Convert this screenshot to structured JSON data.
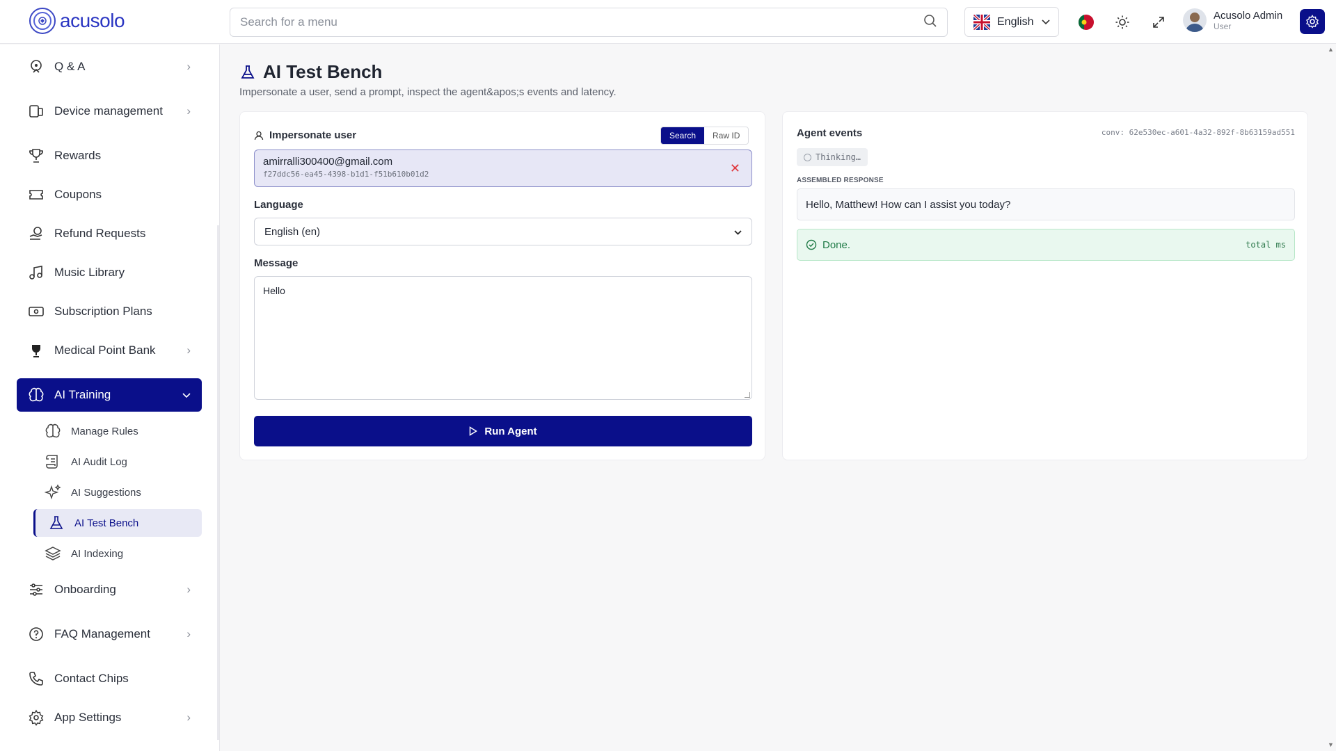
{
  "header": {
    "logo_text": "acusolo",
    "search_placeholder": "Search for a menu",
    "language": "English",
    "user_name": "Acusolo Admin",
    "user_role": "User"
  },
  "sidebar": {
    "items": [
      {
        "label": "Q & A",
        "icon": "qa-icon"
      },
      {
        "label": "Device management",
        "icon": "device-icon"
      },
      {
        "label": "Rewards",
        "icon": "trophy-icon"
      },
      {
        "label": "Coupons",
        "icon": "ticket-icon"
      },
      {
        "label": "Refund Requests",
        "icon": "refund-icon"
      },
      {
        "label": "Music Library",
        "icon": "music-icon"
      },
      {
        "label": "Subscription Plans",
        "icon": "subscription-icon"
      },
      {
        "label": "Medical Point Bank",
        "icon": "medal-icon"
      },
      {
        "label": "AI Training",
        "icon": "brain-icon"
      },
      {
        "label": "Onboarding",
        "icon": "sliders-icon"
      },
      {
        "label": "FAQ Management",
        "icon": "help-icon"
      },
      {
        "label": "Contact Chips",
        "icon": "phone-icon"
      },
      {
        "label": "App Settings",
        "icon": "gear-icon"
      }
    ],
    "sub_items": [
      {
        "label": "Manage Rules",
        "icon": "brain-icon"
      },
      {
        "label": "AI Audit Log",
        "icon": "scroll-icon"
      },
      {
        "label": "AI Suggestions",
        "icon": "sparkles-icon"
      },
      {
        "label": "AI Test Bench",
        "icon": "flask-icon"
      },
      {
        "label": "AI Indexing",
        "icon": "layers-icon"
      }
    ]
  },
  "page": {
    "title": "AI Test Bench",
    "subtitle": "Impersonate a user, send a prompt, inspect the agent&apos;s events and latency."
  },
  "form": {
    "impersonate_label": "Impersonate user",
    "toggle_search": "Search",
    "toggle_raw": "Raw ID",
    "user_email": "amirralli300400@gmail.com",
    "user_id": "f27ddc56-ea45-4398-b1d1-f51b610b01d2",
    "language_label": "Language",
    "language_value": "English (en)",
    "message_label": "Message",
    "message_value": "Hello",
    "run_label": "Run Agent"
  },
  "events": {
    "title": "Agent events",
    "conv": "conv: 62e530ec-a601-4a32-892f-8b63159ad551",
    "thinking": "Thinking…",
    "assembled_label": "ASSEMBLED RESPONSE",
    "response": "Hello, Matthew! How can I assist you today?",
    "done": "Done.",
    "total": "total ms"
  },
  "colors": {
    "primary": "#0a0f8a",
    "success_bg": "#e9f8ef",
    "danger": "#e0363c"
  }
}
